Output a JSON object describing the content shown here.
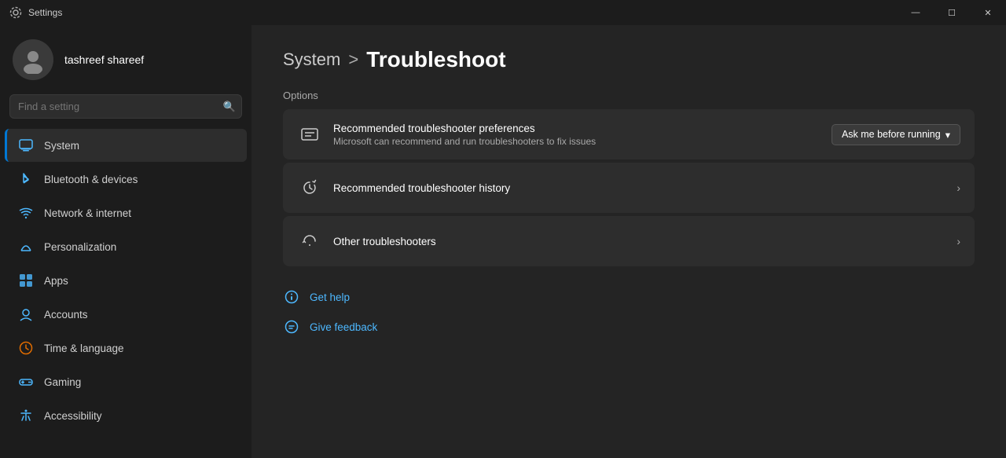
{
  "titlebar": {
    "title": "Settings",
    "minimize_label": "—",
    "maximize_label": "☐",
    "close_label": "✕"
  },
  "sidebar": {
    "username": "tashreef shareef",
    "search_placeholder": "Find a setting",
    "nav_items": [
      {
        "id": "system",
        "label": "System",
        "active": true
      },
      {
        "id": "bluetooth",
        "label": "Bluetooth & devices",
        "active": false
      },
      {
        "id": "network",
        "label": "Network & internet",
        "active": false
      },
      {
        "id": "personalization",
        "label": "Personalization",
        "active": false
      },
      {
        "id": "apps",
        "label": "Apps",
        "active": false
      },
      {
        "id": "accounts",
        "label": "Accounts",
        "active": false
      },
      {
        "id": "time",
        "label": "Time & language",
        "active": false
      },
      {
        "id": "gaming",
        "label": "Gaming",
        "active": false
      },
      {
        "id": "accessibility",
        "label": "Accessibility",
        "active": false
      }
    ]
  },
  "content": {
    "breadcrumb_parent": "System",
    "breadcrumb_separator": ">",
    "breadcrumb_current": "Troubleshoot",
    "section_label": "Options",
    "options": [
      {
        "id": "preferences",
        "title": "Recommended troubleshooter preferences",
        "subtitle": "Microsoft can recommend and run troubleshooters to fix issues",
        "has_dropdown": true,
        "dropdown_value": "Ask me before running"
      },
      {
        "id": "history",
        "title": "Recommended troubleshooter history",
        "subtitle": "",
        "has_dropdown": false
      },
      {
        "id": "other",
        "title": "Other troubleshooters",
        "subtitle": "",
        "has_dropdown": false
      }
    ],
    "links": [
      {
        "id": "help",
        "label": "Get help"
      },
      {
        "id": "feedback",
        "label": "Give feedback"
      }
    ]
  }
}
